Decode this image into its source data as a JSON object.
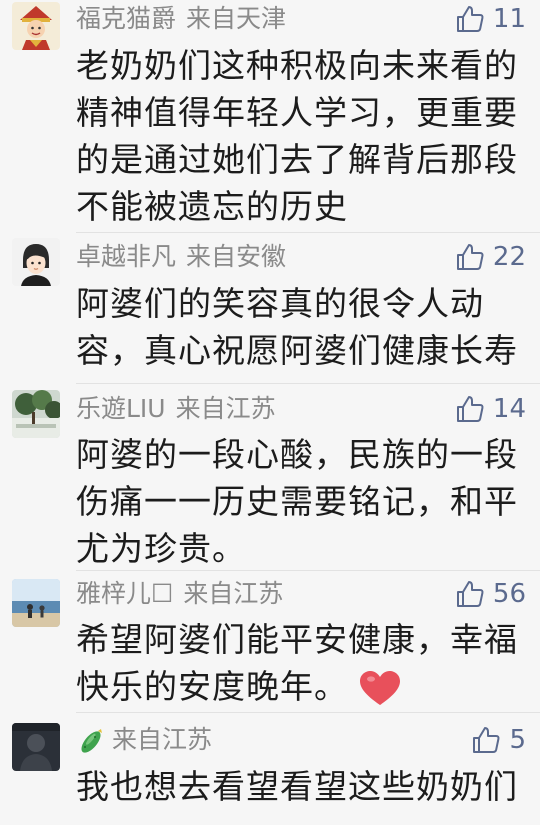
{
  "comments": [
    {
      "username": "福克猫爵",
      "location": "来自天津",
      "likes": "11",
      "lines": [
        "老奶奶们这种积极向未来看的",
        "精神值得年轻人学习，更重要",
        "的是通过她们去了解背后那段",
        "不能被遗忘的历史"
      ]
    },
    {
      "username": "卓越非凡",
      "location": "来自安徽",
      "likes": "22",
      "lines": [
        "阿婆们的笑容真的很令人动",
        "容，真心祝愿阿婆们健康长寿"
      ]
    },
    {
      "username": "乐遊LIU",
      "location": "来自江苏",
      "likes": "14",
      "lines": [
        "阿婆的一段心酸，民族的一段",
        "伤痛一一历史需要铭记，和平",
        "尤为珍贵。"
      ]
    },
    {
      "username": "雅梓儿☐",
      "location": "来自江苏",
      "likes": "56",
      "lines": [
        "希望阿婆们能平安健康，幸福",
        "快乐的安度晚年。"
      ]
    },
    {
      "username": "",
      "location": "来自江苏",
      "likes": "5",
      "lines": [
        "我也想去看望看望这些奶奶们"
      ]
    }
  ],
  "icons": {
    "like": "thumbs-up-outline-icon",
    "heart": "red-heart-emoji",
    "username_emoji": "green-cucumber-icon"
  },
  "colors": {
    "background": "#f6f6f6",
    "meta_text": "#8a8a8a",
    "like_blue": "#5b6a8e",
    "body_text": "#1c1c1c",
    "heart": "#e8505b"
  }
}
